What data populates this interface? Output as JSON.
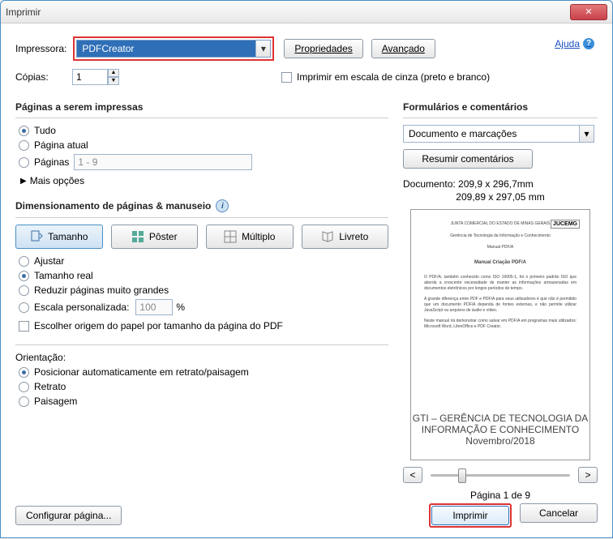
{
  "title": "Imprimir",
  "help": "Ajuda",
  "printer": {
    "label": "Impressora:",
    "selected": "PDFCreator",
    "properties_btn": "Propriedades",
    "advanced_btn": "Avançado"
  },
  "copies": {
    "label": "Cópias:",
    "value": "1"
  },
  "grayscale": {
    "label": "Imprimir em escala de cinza (preto e branco)"
  },
  "pages": {
    "heading": "Páginas a serem impressas",
    "all": "Tudo",
    "current": "Página atual",
    "range_label": "Páginas",
    "range_value": "1 - 9",
    "more": "Mais opções"
  },
  "sizing": {
    "heading": "Dimensionamento de páginas & manuseio",
    "btn_size": "Tamanho",
    "btn_poster": "Pôster",
    "btn_multiple": "Múltiplo",
    "btn_booklet": "Livreto",
    "fit": "Ajustar",
    "actual": "Tamanho real",
    "shrink": "Reduzir páginas muito grandes",
    "custom": "Escala personalizada:",
    "custom_value": "100",
    "custom_unit": "%",
    "paper_source": "Escolher origem do papel por tamanho da página do PDF"
  },
  "orientation": {
    "heading": "Orientação:",
    "auto": "Posicionar automaticamente em retrato/paisagem",
    "portrait": "Retrato",
    "landscape": "Paisagem"
  },
  "forms": {
    "heading": "Formulários e comentários",
    "selected": "Documento e marcações",
    "summarize_btn": "Resumir comentários"
  },
  "preview": {
    "doc_dim": "Documento: 209,9 x 296,7mm",
    "paper_dim": "209,89 x 297,05 mm",
    "page_indicator": "Página 1 de 9",
    "nav_prev": "<",
    "nav_next": ">",
    "logo": "JUCEMG",
    "header1": "JUNTA COMERCIAL DO ESTADO DE MINAS GERAIS",
    "header2": "Gerência de Tecnologia da Informação e Conhecimento",
    "header3": "Manual PDF/A",
    "doc_title": "Manual Criação PDF/A",
    "footer1": "GTI – GERÊNCIA DE TECNOLOGIA DA INFORMAÇÃO E CONHECIMENTO",
    "footer2": "Novembro/2018"
  },
  "buttons": {
    "page_setup": "Configurar página...",
    "print": "Imprimir",
    "cancel": "Cancelar"
  }
}
